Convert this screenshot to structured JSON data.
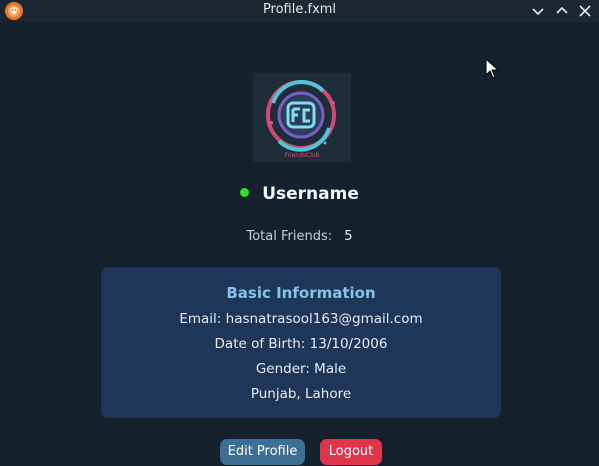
{
  "window": {
    "title": "Profile.fxml"
  },
  "profile": {
    "username": "Username",
    "status_color": "#2ee02e",
    "friends_label": "Total Friends:",
    "friends_count": "5",
    "logo_text": "FriendsClub"
  },
  "info": {
    "title": "Basic Information",
    "email": "Email: hasnatrasool163@gmail.com",
    "dob": "Date of Birth: 13/10/2006",
    "gender": "Gender: Male",
    "location": "Punjab, Lahore"
  },
  "actions": {
    "edit_label": "Edit Profile",
    "logout_label": "Logout"
  },
  "colors": {
    "background": "#15222e",
    "card": "#1e3758",
    "card_title": "#86c2ea",
    "edit_button": "#3d6e93",
    "logout_button": "#e0354a"
  }
}
